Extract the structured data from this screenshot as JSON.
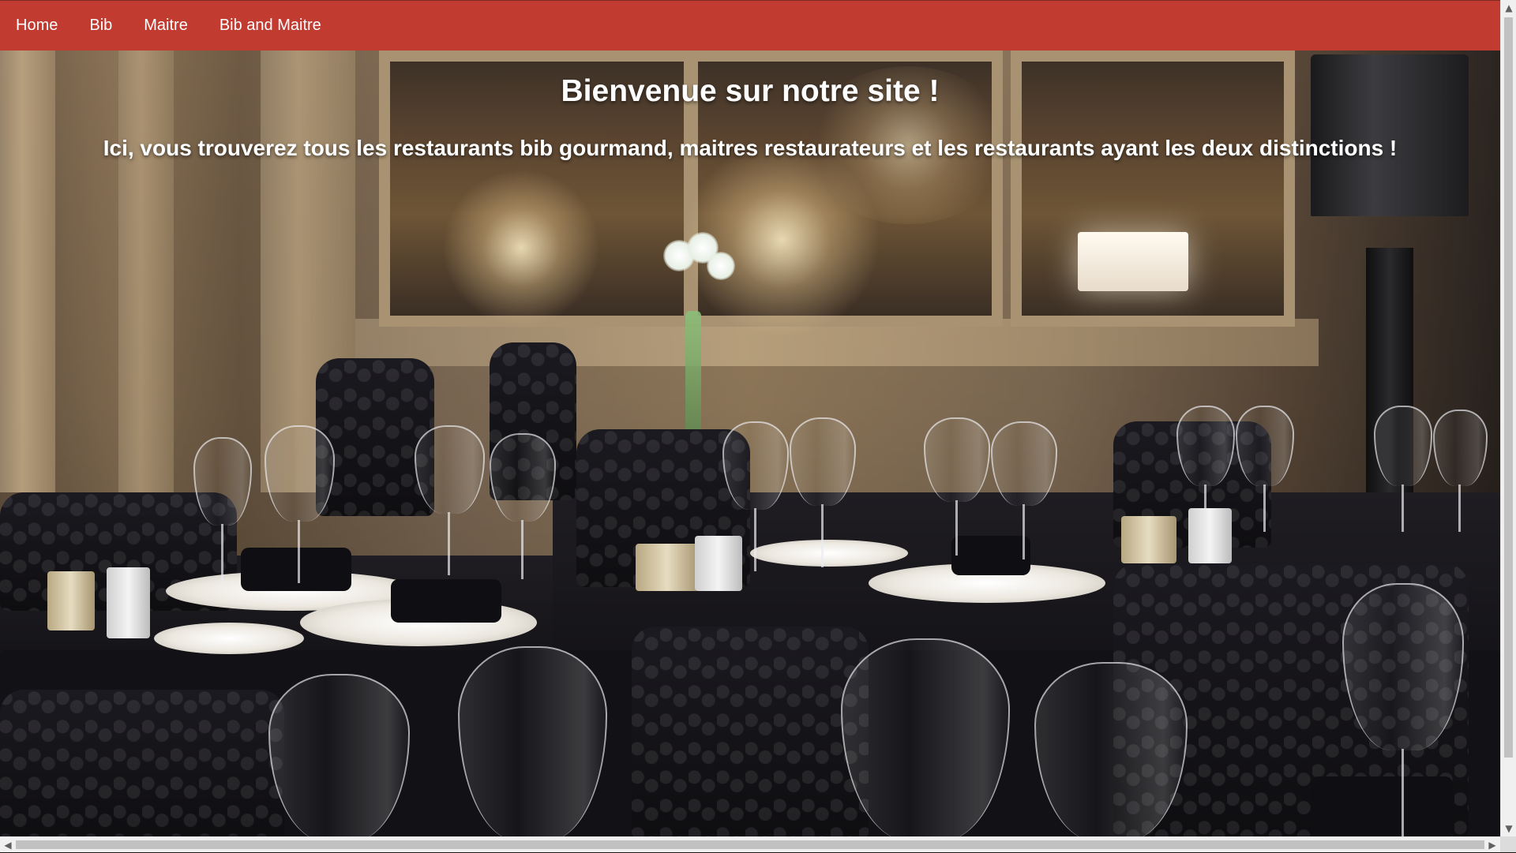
{
  "nav": {
    "items": [
      {
        "label": "Home"
      },
      {
        "label": "Bib"
      },
      {
        "label": "Maitre"
      },
      {
        "label": "Bib and Maitre"
      }
    ],
    "color": "#c13b31"
  },
  "hero": {
    "title": "Bienvenue sur notre site !",
    "subtitle": "Ici, vous trouverez tous les restaurants bib gourmand, maitres restaurateurs et les restaurants ayant les deux distinctions !",
    "background_image": "restaurant dining room with set tables and wine glasses"
  },
  "scrollbars": {
    "up_icon": "chevron-up-icon",
    "down_icon": "chevron-down-icon",
    "left_icon": "chevron-left-icon",
    "right_icon": "chevron-right-icon"
  }
}
